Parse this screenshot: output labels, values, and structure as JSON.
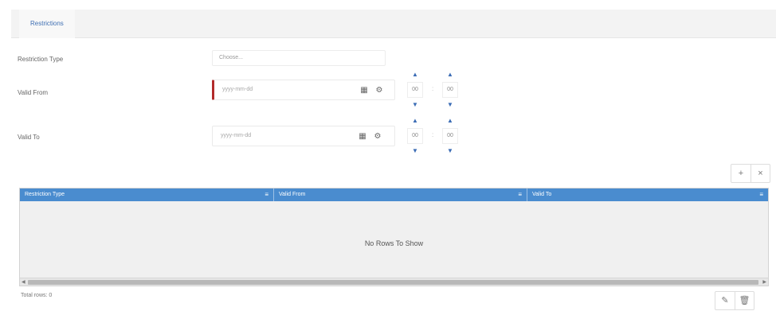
{
  "tabs": [
    {
      "label": "Restrictions"
    }
  ],
  "form": {
    "restriction_type": {
      "label": "Restriction Type",
      "placeholder": "Choose..."
    },
    "valid_from": {
      "label": "Valid From",
      "placeholder": "yyyy-mm-dd",
      "hours": "00",
      "minutes": "00",
      "required": true
    },
    "valid_to": {
      "label": "Valid To",
      "placeholder": "yyyy-mm-dd",
      "hours": "00",
      "minutes": "00"
    }
  },
  "icons": {
    "calendar": "▦",
    "gear": "⚙",
    "up": "▲",
    "down": "▼",
    "add": "+",
    "remove": "×",
    "edit": "✎",
    "delete": "🗑",
    "menu": "≡"
  },
  "grid": {
    "columns": [
      "Restriction Type",
      "Valid From",
      "Valid To"
    ],
    "empty_text": "No Rows To Show",
    "header_color": "#4a8ccf"
  },
  "footer": {
    "total_text": "Total rows: 0"
  }
}
